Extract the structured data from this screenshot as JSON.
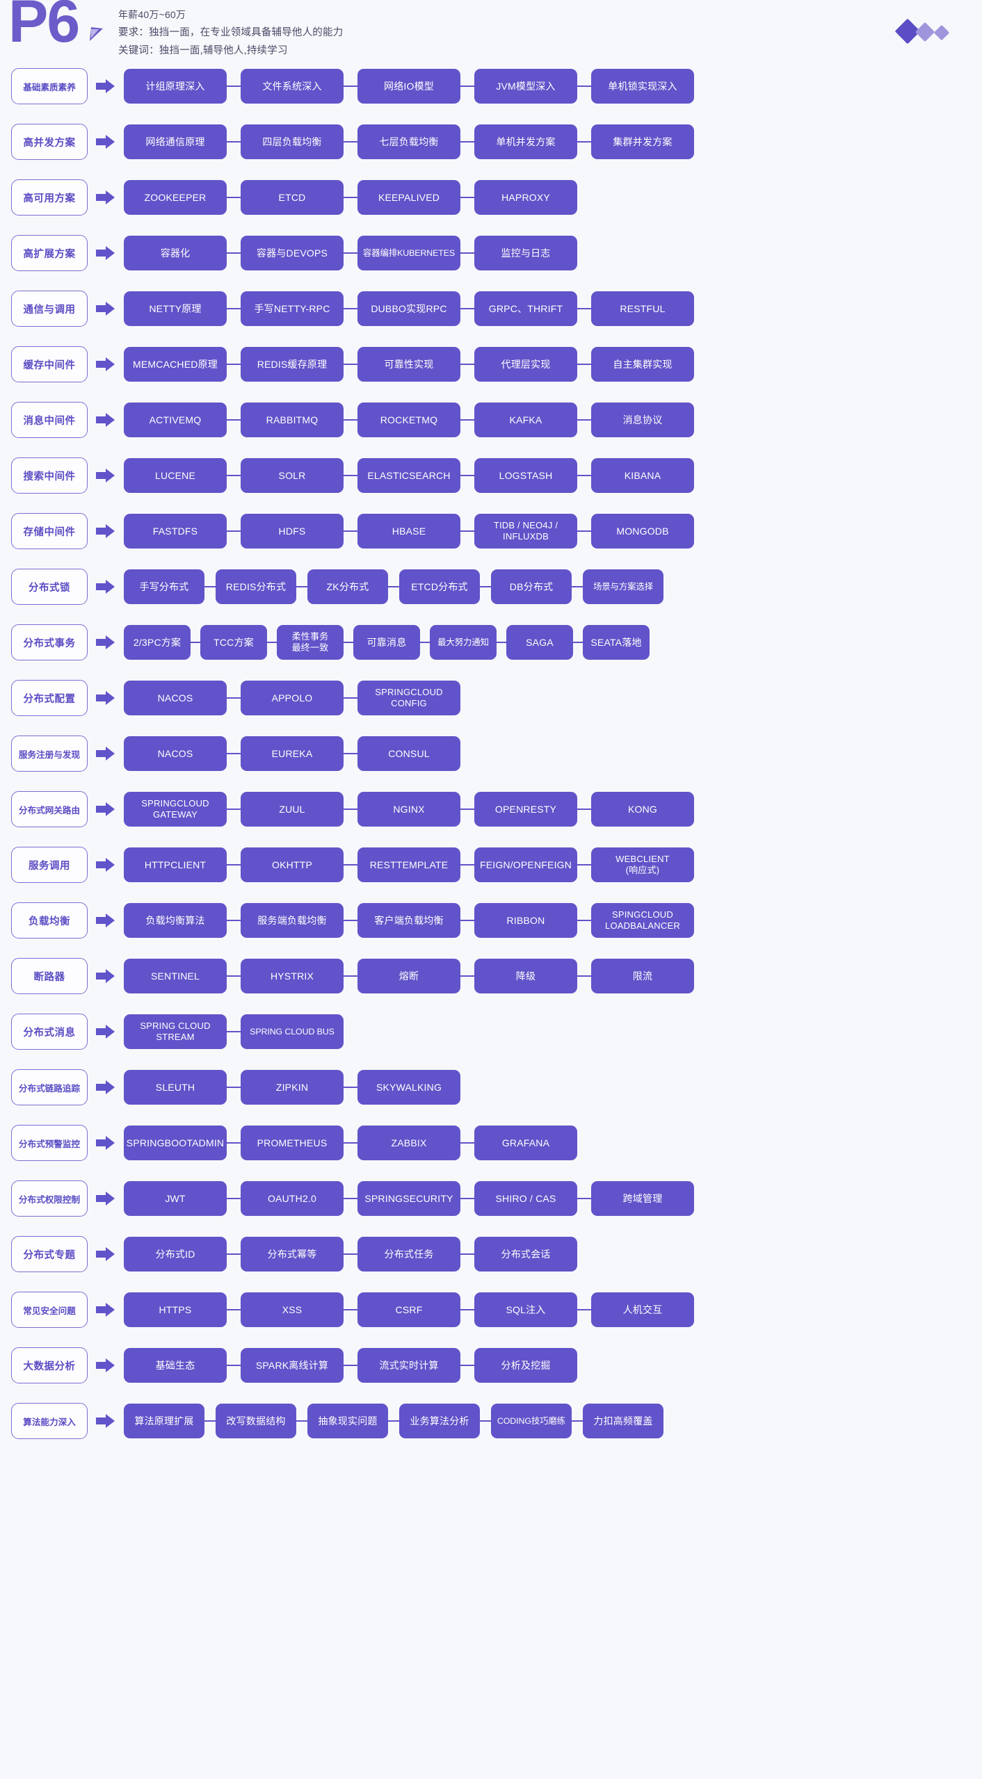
{
  "header": {
    "level_badge": "P6",
    "salary": "年薪40万~60万",
    "requirement": "要求：独挡一面，在专业领域具备辅导他人的能力",
    "keywords": "关键词：独挡一面,辅导他人,持续学习",
    "accent_color": "#6153c9",
    "accent_light": "#9e95dd",
    "background_color": "#f7f8fb",
    "decor": [
      "diamond-large",
      "diamond-medium",
      "diamond-small"
    ]
  },
  "rows": [
    {
      "label": "基础素质素养",
      "items": [
        "计组原理深入",
        "文件系统深入",
        "网络IO模型",
        "JVM模型深入",
        "单机锁实现深入"
      ]
    },
    {
      "label": "高并发方案",
      "items": [
        "网络通信原理",
        "四层负载均衡",
        "七层负载均衡",
        "单机并发方案",
        "集群并发方案"
      ]
    },
    {
      "label": "高可用方案",
      "items": [
        "ZOOKEEPER",
        "ETCD",
        "KEEPALIVED",
        "HAPROXY"
      ]
    },
    {
      "label": "高扩展方案",
      "items": [
        "容器化",
        "容器与DEVOPS",
        "容器编排KUBERNETES",
        "监控与日志"
      ]
    },
    {
      "label": "通信与调用",
      "items": [
        "NETTY原理",
        "手写NETTY-RPC",
        "DUBBO实现RPC",
        "GRPC、THRIFT",
        "RESTFUL"
      ]
    },
    {
      "label": "缓存中间件",
      "items": [
        "MEMCACHED原理",
        "REDIS缓存原理",
        "可靠性实现",
        "代理层实现",
        "自主集群实现"
      ]
    },
    {
      "label": "消息中间件",
      "items": [
        "ACTIVEMQ",
        "RABBITMQ",
        "ROCKETMQ",
        "KAFKA",
        "消息协议"
      ]
    },
    {
      "label": "搜索中间件",
      "items": [
        "LUCENE",
        "SOLR",
        "ELASTICSEARCH",
        "LOGSTASH",
        "KIBANA"
      ]
    },
    {
      "label": "存储中间件",
      "items": [
        "FASTDFS",
        "HDFS",
        "HBASE",
        "TIDB / NEO4J /\nINFLUXDB",
        "MONGODB"
      ]
    },
    {
      "label": "分布式锁",
      "items": [
        "手写分布式",
        "REDIS分布式",
        "ZK分布式",
        "ETCD分布式",
        "DB分布式",
        "场景与方案选择"
      ]
    },
    {
      "label": "分布式事务",
      "items": [
        "2/3PC方案",
        "TCC方案",
        "柔性事务\n最终一致",
        "可靠消息",
        "最大努力通知",
        "SAGA",
        "SEATA落地"
      ]
    },
    {
      "label": "分布式配置",
      "items": [
        "NACOS",
        "APPOLO",
        "SPRINGCLOUD\nCONFIG"
      ]
    },
    {
      "label": "服务注册与发现",
      "items": [
        "NACOS",
        "EUREKA",
        "CONSUL"
      ]
    },
    {
      "label": "分布式网关路由",
      "items": [
        "SPRINGCLOUD\nGATEWAY",
        "ZUUL",
        "NGINX",
        "OPENRESTY",
        "KONG"
      ]
    },
    {
      "label": "服务调用",
      "items": [
        "HTTPCLIENT",
        "OKHTTP",
        "RESTTEMPLATE",
        "FEIGN/OPENFEIGN",
        "WEBCLIENT\n(响应式)"
      ]
    },
    {
      "label": "负载均衡",
      "items": [
        "负载均衡算法",
        "服务端负载均衡",
        "客户端负载均衡",
        "RIBBON",
        "SPINGCLOUD\nLOADBALANCER"
      ]
    },
    {
      "label": "断路器",
      "items": [
        "SENTINEL",
        "HYSTRIX",
        "熔断",
        "降级",
        "限流"
      ]
    },
    {
      "label": "分布式消息",
      "items": [
        "SPRING CLOUD\nSTREAM",
        "SPRING CLOUD BUS"
      ]
    },
    {
      "label": "分布式链路追踪",
      "items": [
        "SLEUTH",
        "ZIPKIN",
        "SKYWALKING"
      ]
    },
    {
      "label": "分布式预警监控",
      "items": [
        "SPRINGBOOTADMIN",
        "PROMETHEUS",
        "ZABBIX",
        "GRAFANA"
      ]
    },
    {
      "label": "分布式权限控制",
      "items": [
        "JWT",
        "OAUTH2.0",
        "SPRINGSECURITY",
        "SHIRO / CAS",
        "跨域管理"
      ]
    },
    {
      "label": "分布式专题",
      "items": [
        "分布式ID",
        "分布式幂等",
        "分布式任务",
        "分布式会话"
      ]
    },
    {
      "label": "常见安全问题",
      "items": [
        "HTTPS",
        "XSS",
        "CSRF",
        "SQL注入",
        "人机交互"
      ]
    },
    {
      "label": "大数据分析",
      "items": [
        "基础生态",
        "SPARK离线计算",
        "流式实时计算",
        "分析及挖掘"
      ]
    },
    {
      "label": "算法能力深入",
      "items": [
        "算法原理扩展",
        "改写数据结构",
        "抽象现实问题",
        "业务算法分析",
        "CODING技巧磨练",
        "力扣高频覆盖"
      ]
    }
  ]
}
